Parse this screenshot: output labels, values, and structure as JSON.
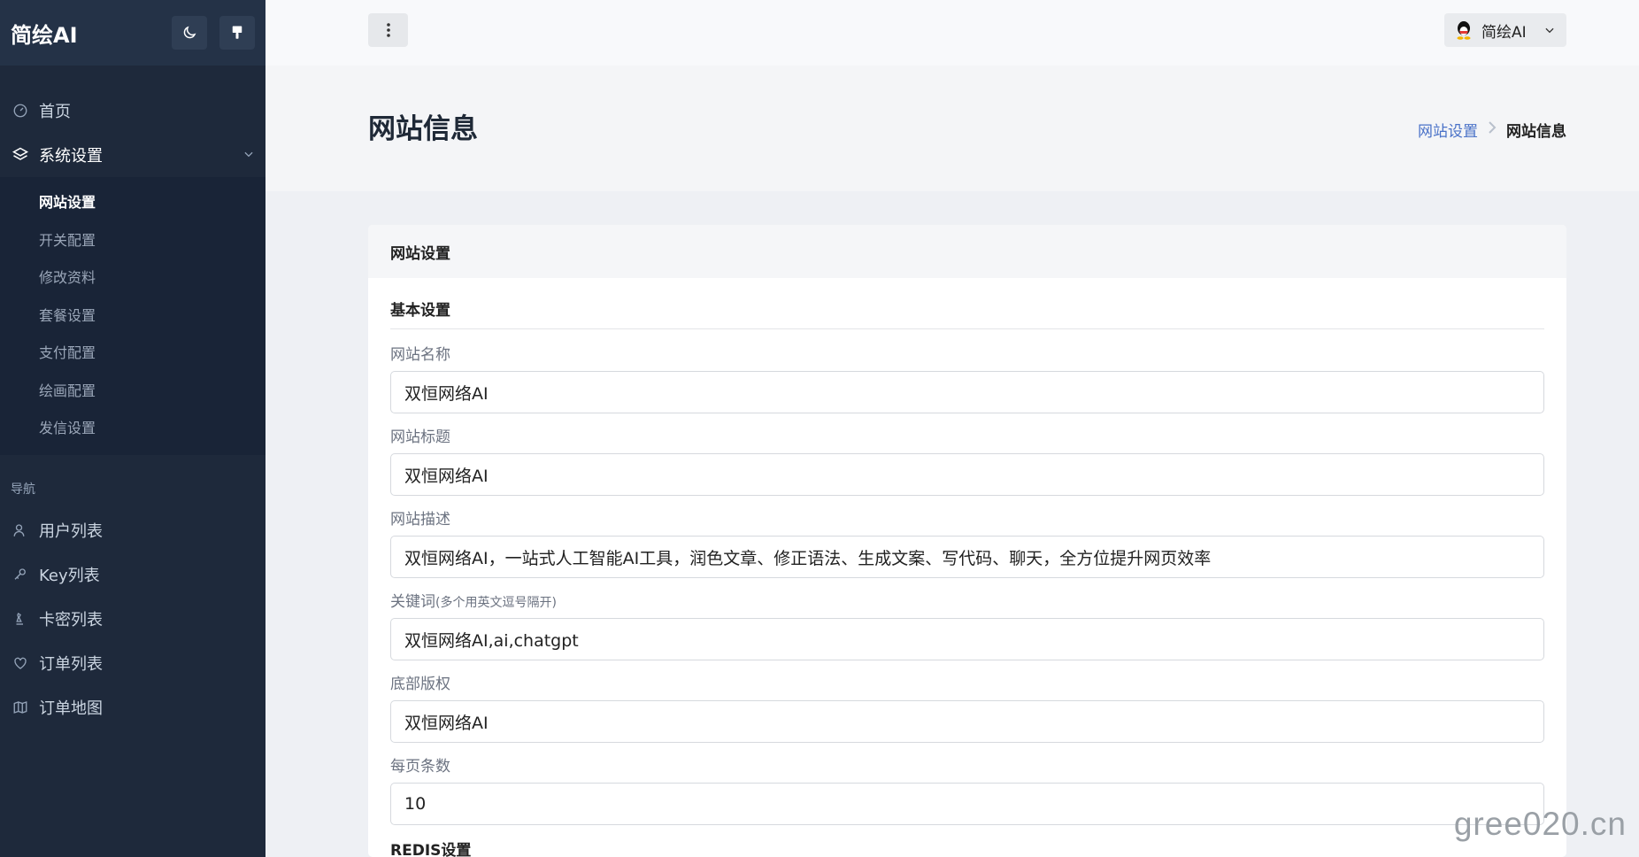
{
  "sidebar": {
    "brand": "简绘AI",
    "nav_top": [
      {
        "label": "首页",
        "icon": "dashboard-icon"
      },
      {
        "label": "系统设置",
        "icon": "layers-icon"
      }
    ],
    "submenu": [
      {
        "label": "网站设置"
      },
      {
        "label": "开关配置"
      },
      {
        "label": "修改资料"
      },
      {
        "label": "套餐设置"
      },
      {
        "label": "支付配置"
      },
      {
        "label": "绘画配置"
      },
      {
        "label": "发信设置"
      }
    ],
    "section_title": "导航",
    "nav_bottom": [
      {
        "label": "用户列表",
        "icon": "users-icon"
      },
      {
        "label": "Key列表",
        "icon": "key-icon"
      },
      {
        "label": "卡密列表",
        "icon": "chess-icon"
      },
      {
        "label": "订单列表",
        "icon": "heart-icon"
      },
      {
        "label": "订单地图",
        "icon": "map-icon"
      }
    ]
  },
  "topbar": {
    "user_name": "简绘AI"
  },
  "page": {
    "title": "网站信息",
    "breadcrumb_parent": "网站设置",
    "breadcrumb_current": "网站信息"
  },
  "card": {
    "title": "网站设置",
    "group_basic": "基本设置",
    "fields": [
      {
        "label": "网站名称",
        "hint": "",
        "value": "双恒网络AI"
      },
      {
        "label": "网站标题",
        "hint": "",
        "value": "双恒网络AI"
      },
      {
        "label": "网站描述",
        "hint": "",
        "value": "双恒网络AI，一站式人工智能AI工具，润色文章、修正语法、生成文案、写代码、聊天，全方位提升网页效率"
      },
      {
        "label": "关键词",
        "hint": "(多个用英文逗号隔开)",
        "value": "双恒网络AI,ai,chatgpt"
      },
      {
        "label": "底部版权",
        "hint": "",
        "value": "双恒网络AI"
      },
      {
        "label": "每页条数",
        "hint": "",
        "value": "10"
      }
    ],
    "group_redis": "REDIS设置"
  },
  "watermark": "gree020.cn",
  "colors": {
    "sidebar_bg": "#1e293b",
    "accent_link": "#4a72c8"
  }
}
